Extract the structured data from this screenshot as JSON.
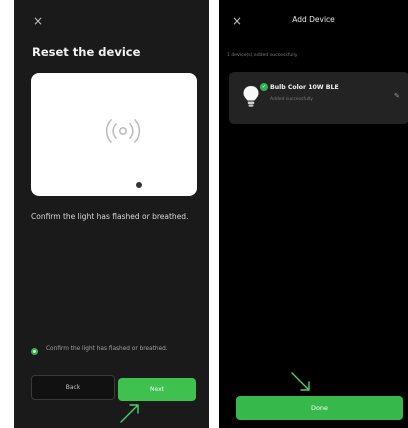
{
  "left_screen": {
    "close_glyph": "×",
    "title": "Reset the device",
    "illustration_icon": "wireless-signal-icon",
    "description": "Confirm the light has flashed or breathed.",
    "checkbox_label": "Confirm the light has flashed or breathed.",
    "checkbox_checked": true,
    "back_label": "Back",
    "next_label": "Next"
  },
  "right_screen": {
    "close_glyph": "×",
    "title": "Add Device",
    "status": "1 device(s) added successfully",
    "device": {
      "name": "Bulb Color 10W BLE",
      "sub": "Added successfully",
      "icon": "bulb-icon",
      "badge_icon": "check-icon"
    },
    "done_label": "Done"
  },
  "colors": {
    "accent_green": "#3ec14f",
    "arrow_green": "#4ad16a",
    "panel_bg": "#1a1a1a"
  }
}
